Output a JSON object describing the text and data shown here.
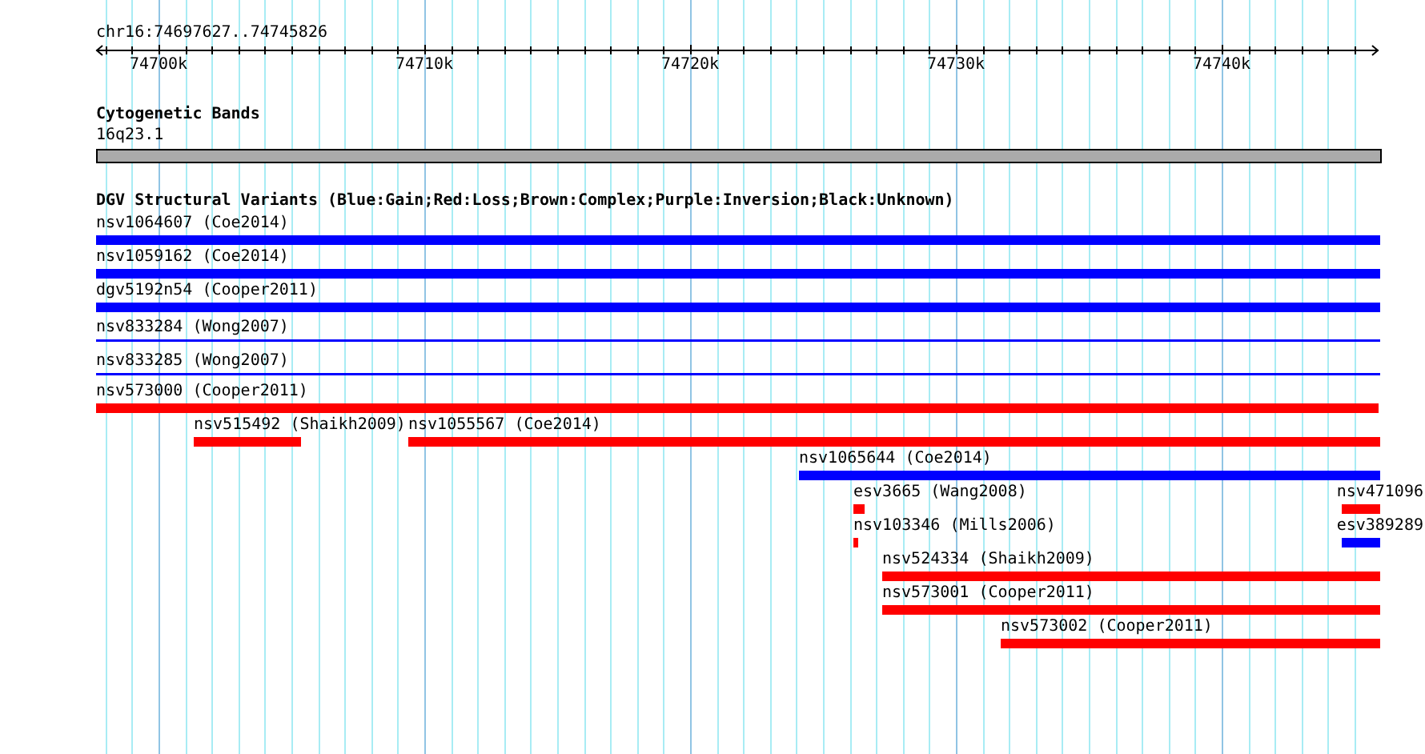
{
  "ruler": {
    "range_label": "chr16:74697627..74745826",
    "ticks": [
      "74700k",
      "74710k",
      "74720k",
      "74730k",
      "74740k"
    ]
  },
  "tracks": [
    {
      "title": "Cytogenetic Bands",
      "features": [
        {
          "label": "16q23.1",
          "kind": "band",
          "color": "#aaaaaa"
        }
      ]
    },
    {
      "title": "DGV Structural Variants (Blue:Gain;Red:Loss;Brown:Complex;Purple:Inversion;Black:Unknown)",
      "features": [
        {
          "label": "nsv1064607 (Coe2014)",
          "kind": "bar",
          "color": "#0000ff"
        },
        {
          "label": "nsv1059162 (Coe2014)",
          "kind": "bar",
          "color": "#0000ff"
        },
        {
          "label": "dgv5192n54 (Cooper2011)",
          "kind": "bar",
          "color": "#0000ff"
        },
        {
          "label": "nsv833284 (Wong2007)",
          "kind": "line",
          "color": "#0000ff"
        },
        {
          "label": "nsv833285 (Wong2007)",
          "kind": "line",
          "color": "#0000ff"
        },
        {
          "label": "nsv573000 (Cooper2011)",
          "kind": "bar",
          "color": "#ff0000"
        },
        {
          "label": "nsv515492 (Shaikh2009)",
          "kind": "bar",
          "color": "#ff0000"
        },
        {
          "label": "nsv1055567 (Coe2014)",
          "kind": "bar",
          "color": "#ff0000"
        },
        {
          "label": "nsv1065644 (Coe2014)",
          "kind": "bar",
          "color": "#0000ff"
        },
        {
          "label": "esv3665 (Wang2008)",
          "kind": "bar",
          "color": "#ff0000"
        },
        {
          "label": "nsv471096",
          "kind": "bar",
          "color": "#ff0000"
        },
        {
          "label": "nsv103346 (Mills2006)",
          "kind": "bar",
          "color": "#ff0000"
        },
        {
          "label": "esv389289",
          "kind": "bar",
          "color": "#0000ff"
        },
        {
          "label": "nsv524334 (Shaikh2009)",
          "kind": "bar",
          "color": "#ff0000"
        },
        {
          "label": "nsv573001 (Cooper2011)",
          "kind": "bar",
          "color": "#ff0000"
        },
        {
          "label": "nsv573002 (Cooper2011)",
          "kind": "bar",
          "color": "#ff0000"
        }
      ]
    }
  ]
}
